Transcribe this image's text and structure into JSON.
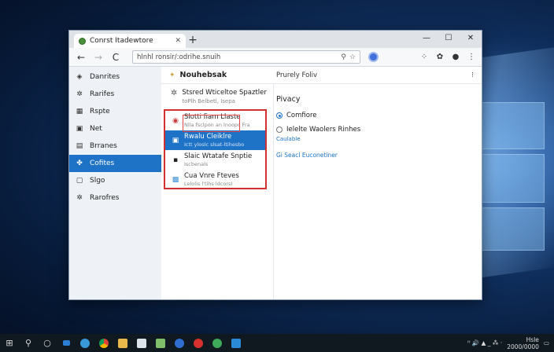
{
  "browser": {
    "tab_title": "Conrst Itadewtore",
    "tab_close": "✕",
    "new_tab": "+",
    "url": "hlnhl ronsir/:odrihe.snuih",
    "window_controls": [
      "—",
      "☐",
      "✕"
    ]
  },
  "toolbar": {
    "back": "←",
    "forward": "→",
    "reload": "C",
    "home": "⌂",
    "right_icons": [
      "⁘",
      "✿",
      "●",
      "⋮"
    ]
  },
  "sidebar": {
    "items": [
      {
        "label": "Danrites",
        "icon": "diamond-icon"
      },
      {
        "label": "Rarifes",
        "icon": "gear-icon"
      },
      {
        "label": "Rspte",
        "icon": "tile-icon"
      },
      {
        "label": "Net",
        "icon": "box-icon"
      },
      {
        "label": "Brranes",
        "icon": "grid-icon"
      },
      {
        "label": "Cofites",
        "icon": "puzzle-icon"
      },
      {
        "label": "Slgo",
        "icon": "doc-icon"
      },
      {
        "label": "Rarofres",
        "icon": "gear-icon"
      }
    ],
    "active_index": 5
  },
  "main": {
    "title": "Nouhebsak",
    "subtitle": "Prurely Foliv",
    "more": "⁝",
    "feature": {
      "title": "Stsred Wticeltoe Spaztler",
      "subtitle": "toPlh Belbetl, Isepa"
    },
    "rows": [
      {
        "title": "Slotti fiam Llaste",
        "subtitle": "Nlla fsclpon an lnoopc Fra"
      },
      {
        "title": "Rwalu Cleiklre",
        "subtitle": "Ictt yloslc slsat-ltihesbo"
      },
      {
        "title": "Slaic Wtatafe Snptie",
        "subtitle": "Iscbenals"
      },
      {
        "title": "Cua Vnre Fteves",
        "subtitle": "Lelolis l'tihs ldcorsl"
      }
    ],
    "selected_row": 1
  },
  "panel": {
    "heading": "Pivacy",
    "option1": "Comfiore",
    "option2": "Ielelte Waolers Rinhes",
    "option2_helper": "Caulable",
    "link": "Gi Seacl Euconetiner"
  },
  "taskbar": {
    "icons": [
      "start-icon",
      "search-icon",
      "cortana-icon",
      "task-view-icon",
      "edge-icon",
      "chrome-icon",
      "folder-icon",
      "photos-icon",
      "notepad-icon",
      "settings-icon",
      "opera-icon",
      "chat-icon",
      "app-icon"
    ],
    "tray_text": "ᴴ 🔊 ▲ _ ⁂ ·",
    "clock_time": "Hsle",
    "clock_date": "2000/0000"
  },
  "colors": {
    "accent": "#1f73c7",
    "highlight": "#d42f2f"
  }
}
